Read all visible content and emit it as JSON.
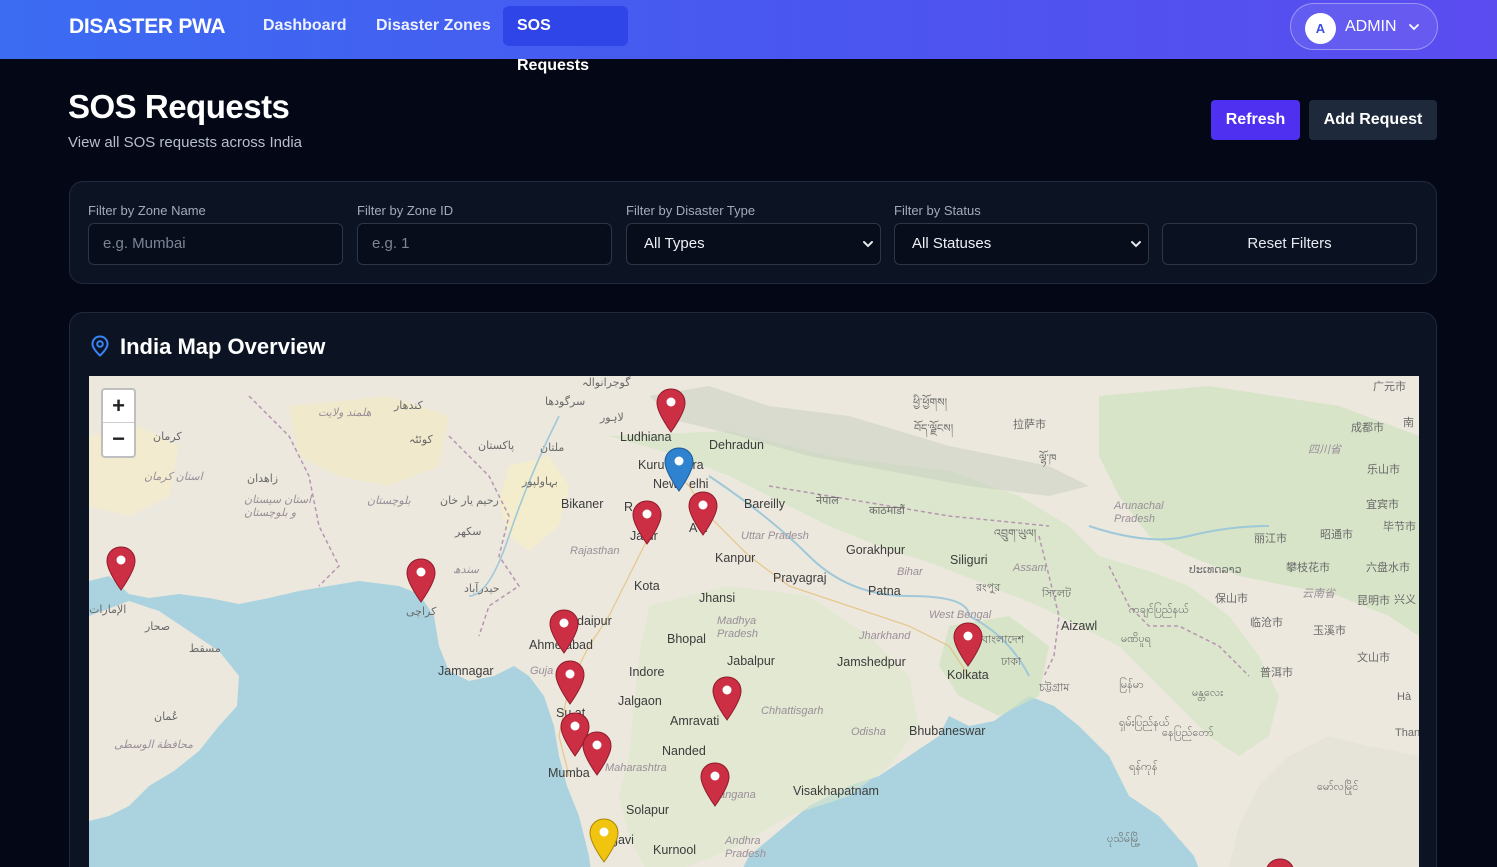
{
  "nav": {
    "brand": "DISASTER PWA",
    "links": [
      "Dashboard",
      "Disaster Zones",
      "SOS Requests"
    ],
    "active": "SOS Requests",
    "user": {
      "initial": "A",
      "name": "ADMIN"
    }
  },
  "header": {
    "title": "SOS Requests",
    "subtitle": "View all SOS requests across India",
    "refresh_label": "Refresh",
    "add_label": "Add Request"
  },
  "filters": {
    "zone_name": {
      "label": "Filter by Zone Name",
      "placeholder": "e.g. Mumbai"
    },
    "zone_id": {
      "label": "Filter by Zone ID",
      "placeholder": "e.g. 1"
    },
    "disaster_type": {
      "label": "Filter by Disaster Type",
      "value": "All Types"
    },
    "status": {
      "label": "Filter by Status",
      "value": "All Statuses"
    },
    "reset_label": "Reset Filters"
  },
  "map": {
    "title": "India Map Overview",
    "zoom_in": "+",
    "zoom_out": "−",
    "labels": {
      "ludhiana": "Ludhiana",
      "dehradun": "Dehradun",
      "kuru": "Kuru",
      "tra": "tra",
      "new": "New",
      "delhi": "elhi",
      "bareilly": "Bareilly",
      "bikaner": "Bikaner",
      "jaipur_r": "R",
      "jaipur": "Ja ur",
      "agra": "A a",
      "uttar_pradesh": "Uttar Pradesh",
      "gorakhpur": "Gorakhpur",
      "siliguri": "Siliguri",
      "rajasthan": "Rajasthan",
      "kanpur": "Kanpur",
      "prayagraj": "Prayagraj",
      "bihar": "Bihar",
      "patna": "Patna",
      "assam": "Assam",
      "kota": "Kota",
      "jhansi": "Jhansi",
      "udaipur": "daipur",
      "madhya_pradesh": "Madhya Pradesh",
      "west_bengal": "West Bengal",
      "aizawl": "Aizawl",
      "ahmedabad": "Ahme abad",
      "bhopal": "Bhopal",
      "jharkhand": "Jharkhand",
      "jamnagar": "Jamnagar",
      "gujarat": "Guja",
      "indore": "Indore",
      "jabalpur": "Jabalpur",
      "jamshedpur": "Jamshedpur",
      "kolkata": "Kolkata",
      "jalgaon": "Jalgaon",
      "surat": "Su at",
      "amravati": "Amravati",
      "chhattisgarh": "Chhattisgarh",
      "odisha": "Odisha",
      "bhubaneswar": "Bhubaneswar",
      "nanded": "Nanded",
      "mumbai": "Mumba",
      "maharashtra": "Maharashtra",
      "telangana": "angana",
      "visakhapatnam": "Visakhapatnam",
      "solapur": "Solapur",
      "belgavi": "gavi",
      "kurnool": "Kurnool",
      "andhra": "Andhra Pradesh",
      "arunachal": "Arunachal Pradesh",
      "lijiang": "丽江市",
      "zhaotong": "昭通市",
      "panzhihua": "攀枝花市",
      "liupanshui": "六盘水市",
      "yunnan": "云南省",
      "kunming": "昆明市",
      "baoshan": "保山市",
      "lincang": "临沧市",
      "yuxi": "玉溪市",
      "puer": "普洱市",
      "wenshan": "文山市",
      "chengdu": "成都市",
      "leshan": "乐山市",
      "yibin": "宜宾市",
      "sichuan": "四川省",
      "lhasa": "拉萨市",
      "guangyuan": "广元市",
      "bijie": "毕节市",
      "xingyi": "兴义",
      "ha": "Hà",
      "thanh": "Thanh",
      "nan": "南",
      "lahore": "لاہور",
      "pakistan": "پاکستان",
      "multan": "ملتان",
      "kandahar": "کندهار",
      "quetta": "کوئٹہ",
      "kerman": "کرمان",
      "karachi": "کراچی",
      "hyderabad_pk": "حیدرآباد",
      "sindh": "سندھ",
      "sukkur": "سکھر",
      "bahawalpur": "بہاولپور",
      "rahimyar": "رحیم یار خان",
      "balochistan": "بلوچستان",
      "zahedan": "زاهدان",
      "oman": "عُمان",
      "uae": "الإمارات",
      "sohar": "صحار",
      "muscat": "مسقط",
      "wusta": "محافظة الوسطى",
      "sargodha": "سرگودھا",
      "gujranwala": "گوجرانوالہ",
      "helmand": "هلمند ولایت",
      "kerman_prov": "استان کرمان",
      "sistan": "استان سیستان و بلوچستان",
      "tibet": "བོད་ལྗོངས།",
      "bhutan": "འབྲུག་ཡུལ།",
      "nepal": "नेपाल",
      "kathmandu": "काठमाडौं",
      "bangladesh": "বাংলাদেশ",
      "dhaka": "ঢাকা",
      "rangpur": "রংপুর",
      "sylhet": "সিলেট",
      "chittagong": "চট্টগ্রাম",
      "myanmar": "မြန်မာ",
      "mandalay": "မန္တလေး",
      "naypyidaw": "နေပြည်တော်",
      "shan": "ရှမ်းပြည်နယ်",
      "manipur": "မဏိပူရ",
      "yangon": "ရန်ကုန်",
      "kachin": "ကချင်ပြည်နယ်",
      "laos": "ປະເທດລາວ",
      "mawlamyine": "မော်လမြိုင်",
      "kyaukpyu": "ပုသိမ်မြို့",
      "xizang": "ཕྱི་ཕྱོགས།",
      "lhoka": "ལྷོ་ཁ"
    }
  }
}
